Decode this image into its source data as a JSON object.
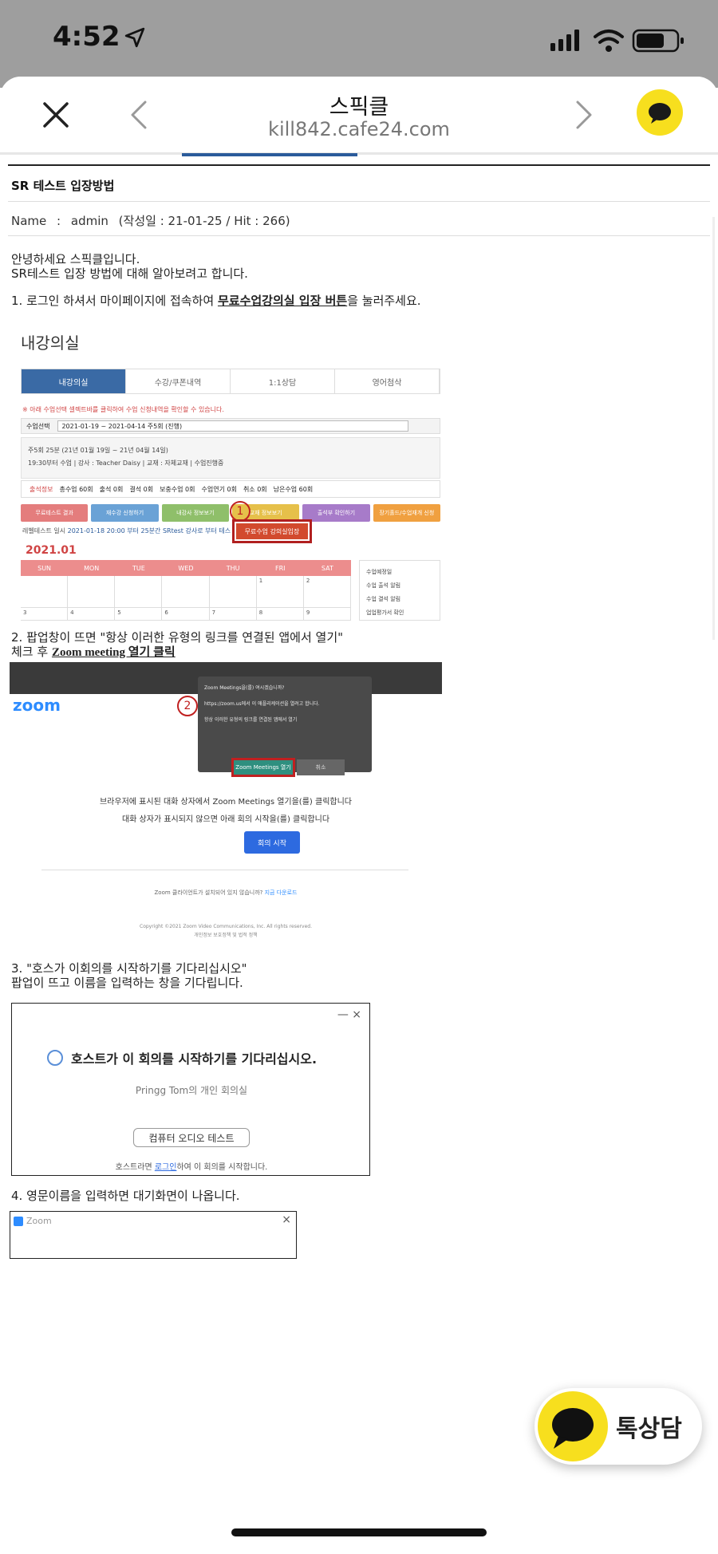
{
  "status": {
    "time": "4:52"
  },
  "nav": {
    "title": "스픽클",
    "url": "kill842.cafe24.com"
  },
  "post": {
    "title": "SR 테스트 입장방법",
    "meta_label": "Name",
    "meta_colon": ":",
    "meta_author": "admin",
    "meta_date_hits": "(작성일 : 21-01-25 / Hit : 266)",
    "intro1": "안녕하세요 스픽클입니다.",
    "intro2": "SR테스트 입장 방법에 대해 알아보려고 합니다.",
    "step1_pre": "1. 로그인 하셔서 마이페이지에 접속하여 ",
    "step1_bold": "무료수업강의실 입장 버튼",
    "step1_post": "을 눌러주세요.",
    "step2_line1": "2. 팝업창이 뜨면 \"항상 이러한 유형의 링크를 연결된 앱에서 열기\"",
    "step2_line2_pre": "체크 후 ",
    "step2_line2_bold": "Zoom meeting 열기 클릭",
    "step3_line1": "3. \"호스가 이회의를 시작하기를 기다리십시오\"",
    "step3_line2": "팝업이 뜨고 이름을 입력하는 창을 기다립니다.",
    "step4_line1": "4. 영문이름을 입력하면 대기화면이 나옵니다."
  },
  "shot1": {
    "heading": "내강의실",
    "tabs": [
      "내강의실",
      "수강/쿠폰내역",
      "1:1상담",
      "영어첨삭"
    ],
    "note": "※ 아래 수업선택 셀렉트바를 클릭하여 수업 신청내역을 확인할 수 있습니다.",
    "select_label": "수업선택",
    "select_value": "2021-01-19 ~ 2021-04-14 주5회 (진행)",
    "info_line1": "주5회 25분 (21년 01월 19일 ~ 21년 04월 14일)",
    "info_line2": "19:30부터 수업 | 강사 : Teacher Daisy | 교재 : 자체교재 | 수업진행중",
    "stats": [
      "출석정보",
      "총수업 60회",
      "출석 0회",
      "결석 0회",
      "보충수업 0회",
      "수업연기 0회",
      "취소 0회",
      "남은수업 60회"
    ],
    "buttons": [
      "무료테스트 결과",
      "재수강 신청하기",
      "내강사 정보보기",
      "교재 정보보기",
      "출석부 확인하기",
      "장기홀드/수업재개 신청"
    ],
    "button_colors": [
      "#e47d7d",
      "#6aa2d6",
      "#8fbf6a",
      "#e6c04a",
      "#a77bc9",
      "#f0a040"
    ],
    "level_label": "레벨테스트 일시",
    "level_value": "2021-01-18 20:00 부터 25분간 SRtest 강사로 부터 테스",
    "free_btn": "무료수업 강의실입장",
    "marker": "1",
    "month": "2021.01",
    "days": [
      "SUN",
      "MON",
      "TUE",
      "WED",
      "THU",
      "FRI",
      "SAT"
    ],
    "week1": [
      "",
      "",
      "",
      "",
      "",
      "1",
      "2"
    ],
    "week2": [
      "3",
      "4",
      "5",
      "6",
      "7",
      "8",
      "9"
    ],
    "legend": [
      "수업예정일",
      "수업 출석 알림",
      "수업 결석 알림",
      "업업평가서 확인"
    ]
  },
  "shot2": {
    "logo": "zoom",
    "marker": "2",
    "dialog_title": "Zoom Meetings을(를) 여시겠습니까?",
    "dialog_desc": "https://zoom.us에서 이 애플리케이션을 열려고 합니다.",
    "dialog_check": "항상 이러한 유형의 링크를 연결된 앱에서 열기",
    "open_btn": "Zoom Meetings 열기",
    "cancel_btn": "취소",
    "line1": "브라우저에 표시된 대화 상자에서 Zoom Meetings 열기을(를) 클릭합니다",
    "line2": "대화 상자가 표시되지 않으면 아래 회의 시작을(를) 클릭합니다",
    "start_btn": "회의 시작",
    "client_text": "Zoom 클라이언트가 설치되어 있지 않습니까?",
    "client_link": "지금 다운로드",
    "copyright": "Copyright ©2021 Zoom Video Communications, Inc. All rights reserved.",
    "policy": "개인정보 보호정책 및 법적 정책"
  },
  "shot3": {
    "controls": "—   ×",
    "waiting": "호스트가 이 회의를 시작하기를 기다리십시오.",
    "room": "Pringg Tom의 개인 회의실",
    "audio_btn": "컴퓨터 오디오 테스트",
    "host_pre": "호스트라면 ",
    "host_link": "로그인",
    "host_post": "하여 이 회의를 시작합니다."
  },
  "shot4": {
    "title": "Zoom",
    "close": "×"
  },
  "chat": {
    "label": "톡상담"
  }
}
